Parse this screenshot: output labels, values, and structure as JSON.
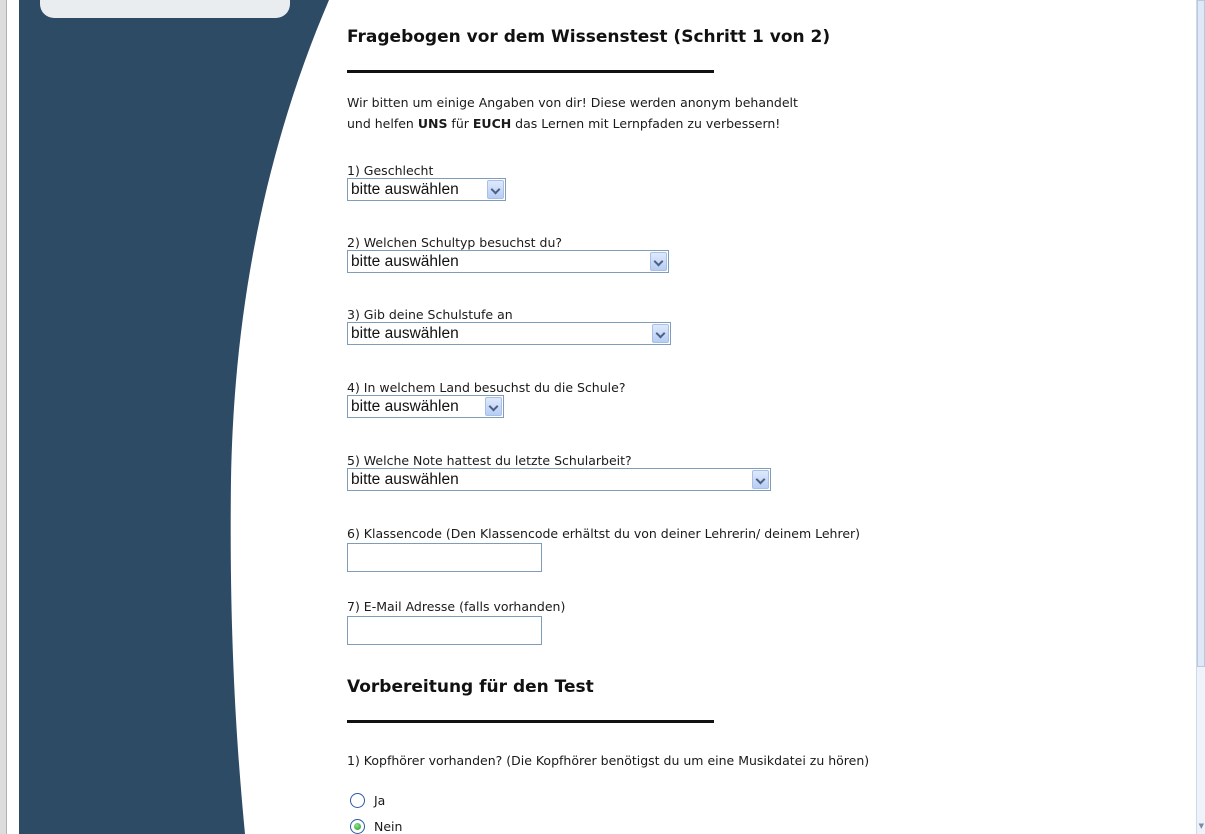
{
  "section1": {
    "title": "Fragebogen vor dem Wissenstest (Schritt 1 von 2)",
    "intro_line1": "Wir bitten um einige Angaben von dir! Diese werden anonym behandelt",
    "intro_pre": "und helfen ",
    "intro_bold1": "UNS",
    "intro_mid": " für ",
    "intro_bold2": "EUCH",
    "intro_post": " das Lernen mit Lernpfaden zu verbessern!",
    "questions": [
      {
        "label": "1) Geschlecht",
        "value": "bitte auswählen"
      },
      {
        "label": "2) Welchen Schultyp besuchst du?",
        "value": "bitte auswählen"
      },
      {
        "label": "3) Gib deine Schulstufe an",
        "value": "bitte auswählen"
      },
      {
        "label": "4) In welchem Land besuchst du die Schule?",
        "value": "bitte auswählen"
      },
      {
        "label": "5) Welche Note hattest du letzte Schularbeit?",
        "value": "bitte auswählen"
      },
      {
        "label": "6) Klassencode (Den Klassencode erhältst du von deiner Lehrerin/ deinem Lehrer)",
        "value": ""
      },
      {
        "label": "7) E-Mail Adresse (falls vorhanden)",
        "value": ""
      }
    ]
  },
  "section2": {
    "title": "Vorbereitung für den Test",
    "question_label": "1) Kopfhörer vorhanden? (Die Kopfhörer benötigst du um eine Musikdatei zu hören)",
    "options": [
      {
        "label": "Ja",
        "checked": false
      },
      {
        "label": "Nein",
        "checked": true
      }
    ]
  },
  "colors": {
    "sidebar": "#2e4b66",
    "select_border": "#7f9db9",
    "radio_selected": "#1f9a1f"
  },
  "icons": [
    "chevron-down-icon",
    "radio-icon"
  ]
}
